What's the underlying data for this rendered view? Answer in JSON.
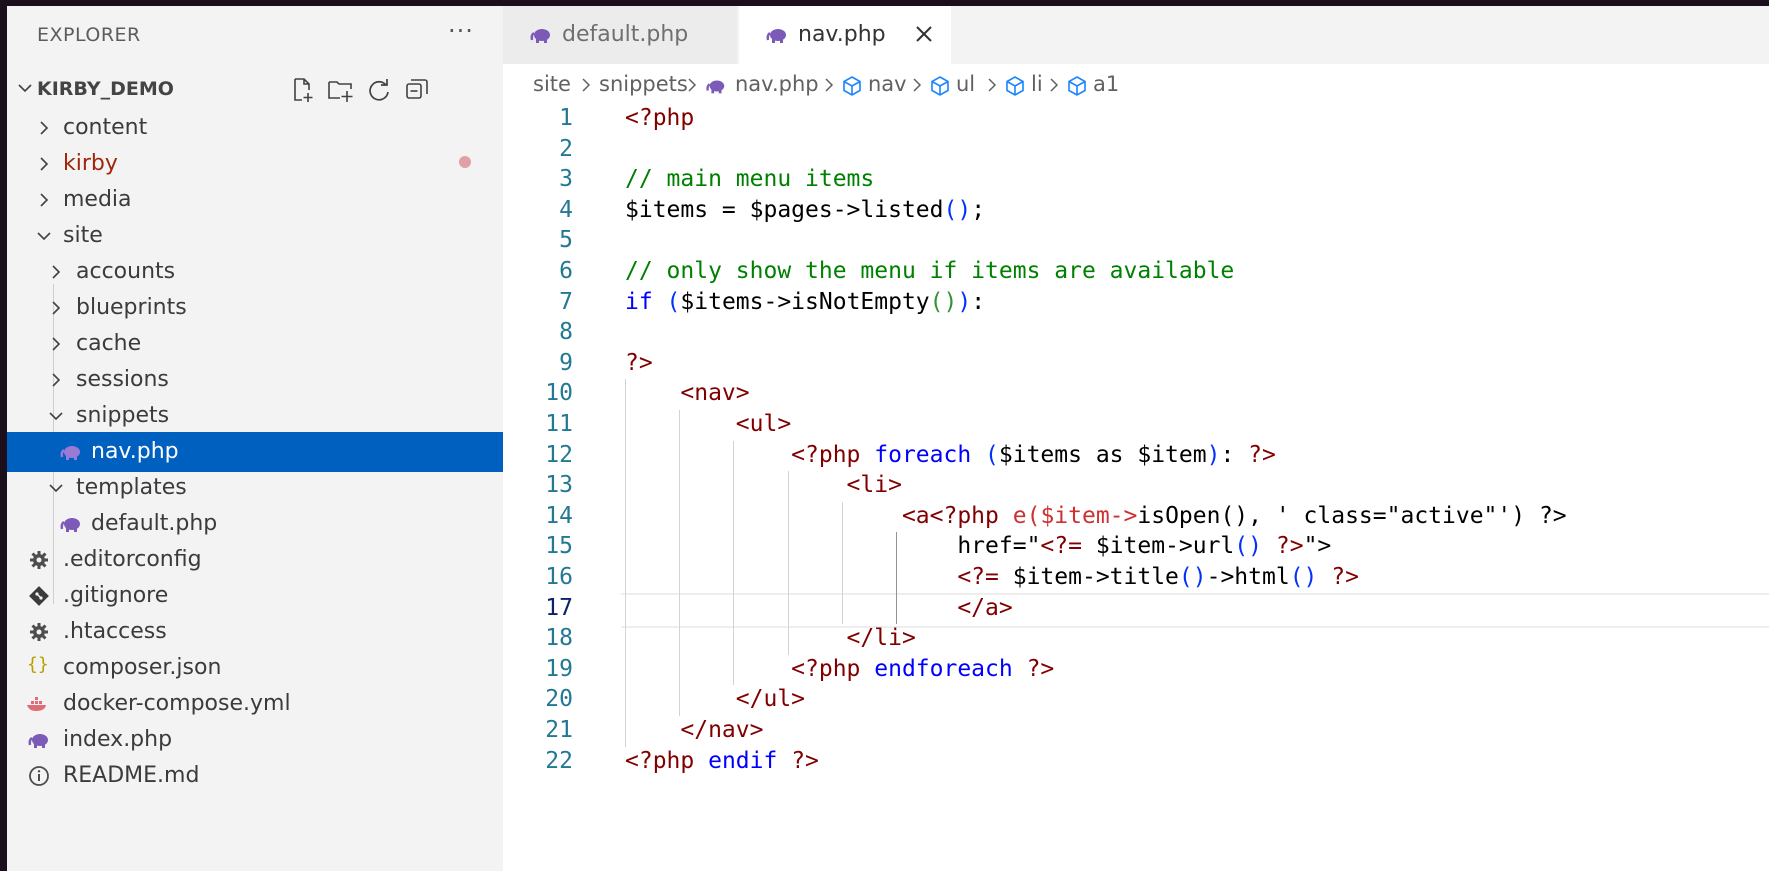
{
  "sidebar": {
    "title": "EXPLORER",
    "more": "···",
    "project": "KIRBY_DEMO",
    "actions": [
      "new-file",
      "new-folder",
      "refresh",
      "collapse-all"
    ],
    "items": [
      {
        "label": "content",
        "type": "folder",
        "state": "collapsed",
        "level": 0
      },
      {
        "label": "kirby",
        "type": "folder",
        "state": "collapsed",
        "level": 0,
        "modified": true,
        "color": "#a1260d"
      },
      {
        "label": "media",
        "type": "folder",
        "state": "collapsed",
        "level": 0
      },
      {
        "label": "site",
        "type": "folder",
        "state": "expanded",
        "level": 0
      },
      {
        "label": "accounts",
        "type": "folder",
        "state": "collapsed",
        "level": 1
      },
      {
        "label": "blueprints",
        "type": "folder",
        "state": "collapsed",
        "level": 1
      },
      {
        "label": "cache",
        "type": "folder",
        "state": "collapsed",
        "level": 1
      },
      {
        "label": "sessions",
        "type": "folder",
        "state": "collapsed",
        "level": 1
      },
      {
        "label": "snippets",
        "type": "folder",
        "state": "expanded",
        "level": 1
      },
      {
        "label": "nav.php",
        "type": "php",
        "level": 2,
        "selected": true
      },
      {
        "label": "templates",
        "type": "folder",
        "state": "expanded",
        "level": 1
      },
      {
        "label": "default.php",
        "type": "php",
        "level": 2
      },
      {
        "label": ".editorconfig",
        "type": "gear",
        "level": 0
      },
      {
        "label": ".gitignore",
        "type": "git",
        "level": 0
      },
      {
        "label": ".htaccess",
        "type": "gear",
        "level": 0
      },
      {
        "label": "composer.json",
        "type": "json",
        "level": 0
      },
      {
        "label": "docker-compose.yml",
        "type": "docker",
        "level": 0
      },
      {
        "label": "index.php",
        "type": "php",
        "level": 0
      },
      {
        "label": "README.md",
        "type": "info",
        "level": 0
      }
    ]
  },
  "tabs": [
    {
      "label": "default.php",
      "active": false
    },
    {
      "label": "nav.php",
      "active": true
    }
  ],
  "breadcrumb": [
    {
      "label": "site"
    },
    {
      "label": "snippets"
    },
    {
      "label": "nav.php",
      "icon": "php"
    },
    {
      "label": "nav",
      "icon": "symbol"
    },
    {
      "label": "ul",
      "icon": "symbol"
    },
    {
      "label": "li",
      "icon": "symbol"
    },
    {
      "label": "a1",
      "icon": "symbol"
    }
  ],
  "editor": {
    "current_line": 17,
    "lines": [
      {
        "n": "1",
        "tokens": [
          [
            "<?php",
            "php"
          ]
        ]
      },
      {
        "n": "2",
        "tokens": []
      },
      {
        "n": "3",
        "tokens": [
          [
            "// main menu items",
            "cm"
          ]
        ]
      },
      {
        "n": "4",
        "tokens": [
          [
            "$items = $pages->listed",
            "def"
          ],
          [
            "()",
            "br1"
          ],
          [
            ";",
            "def"
          ]
        ]
      },
      {
        "n": "5",
        "tokens": []
      },
      {
        "n": "6",
        "tokens": [
          [
            "// only show the menu if items are available",
            "cm"
          ]
        ]
      },
      {
        "n": "7",
        "tokens": [
          [
            "if ",
            "kw"
          ],
          [
            "(",
            "br1"
          ],
          [
            "$items->isNotEmpty",
            "def"
          ],
          [
            "()",
            "br2"
          ],
          [
            ")",
            "br1"
          ],
          [
            ":",
            "def"
          ]
        ]
      },
      {
        "n": "8",
        "tokens": []
      },
      {
        "n": "9",
        "tokens": [
          [
            "?>",
            "php"
          ]
        ]
      },
      {
        "n": "10",
        "tokens": [
          [
            "    <nav>",
            "tag"
          ]
        ]
      },
      {
        "n": "11",
        "tokens": [
          [
            "        <ul>",
            "tag"
          ]
        ]
      },
      {
        "n": "12",
        "tokens": [
          [
            "            <?php ",
            "php"
          ],
          [
            "foreach ",
            "kw"
          ],
          [
            "(",
            "br1"
          ],
          [
            "$items as $item",
            "def"
          ],
          [
            ")",
            "br1"
          ],
          [
            ": ",
            "def"
          ],
          [
            "?>",
            "php"
          ]
        ]
      },
      {
        "n": "13",
        "tokens": [
          [
            "                <li>",
            "tag"
          ]
        ]
      },
      {
        "n": "14",
        "tokens": [
          [
            "                    <a",
            "tag"
          ],
          [
            "<?php ",
            "php"
          ],
          [
            "e(",
            "red"
          ],
          [
            "$item->",
            "red"
          ],
          [
            "isOpen(), ' class=\"active\"') ?>",
            "def"
          ]
        ]
      },
      {
        "n": "15",
        "tokens": [
          [
            "                        href=\"",
            "def"
          ],
          [
            "<?= ",
            "php"
          ],
          [
            "$item->url",
            "def"
          ],
          [
            "()",
            "br1"
          ],
          [
            " ",
            "def"
          ],
          [
            "?>",
            "php"
          ],
          [
            "\">",
            "def"
          ]
        ]
      },
      {
        "n": "16",
        "tokens": [
          [
            "                        <?= ",
            "php"
          ],
          [
            "$item->title",
            "def"
          ],
          [
            "()",
            "br1"
          ],
          [
            "->html",
            "def"
          ],
          [
            "()",
            "br1"
          ],
          [
            " ",
            "def"
          ],
          [
            "?>",
            "php"
          ]
        ]
      },
      {
        "n": "17",
        "tokens": [
          [
            "                        </a>",
            "tag"
          ]
        ]
      },
      {
        "n": "18",
        "tokens": [
          [
            "                </li>",
            "tag"
          ]
        ]
      },
      {
        "n": "19",
        "tokens": [
          [
            "            <?php ",
            "php"
          ],
          [
            "endforeach ",
            "kw"
          ],
          [
            "?>",
            "php"
          ]
        ]
      },
      {
        "n": "20",
        "tokens": [
          [
            "        </ul>",
            "tag"
          ]
        ]
      },
      {
        "n": "21",
        "tokens": [
          [
            "    </nav>",
            "tag"
          ]
        ]
      },
      {
        "n": "22",
        "tokens": [
          [
            "<?php ",
            "php"
          ],
          [
            "endif ",
            "kw"
          ],
          [
            "?>",
            "php"
          ]
        ]
      }
    ]
  }
}
